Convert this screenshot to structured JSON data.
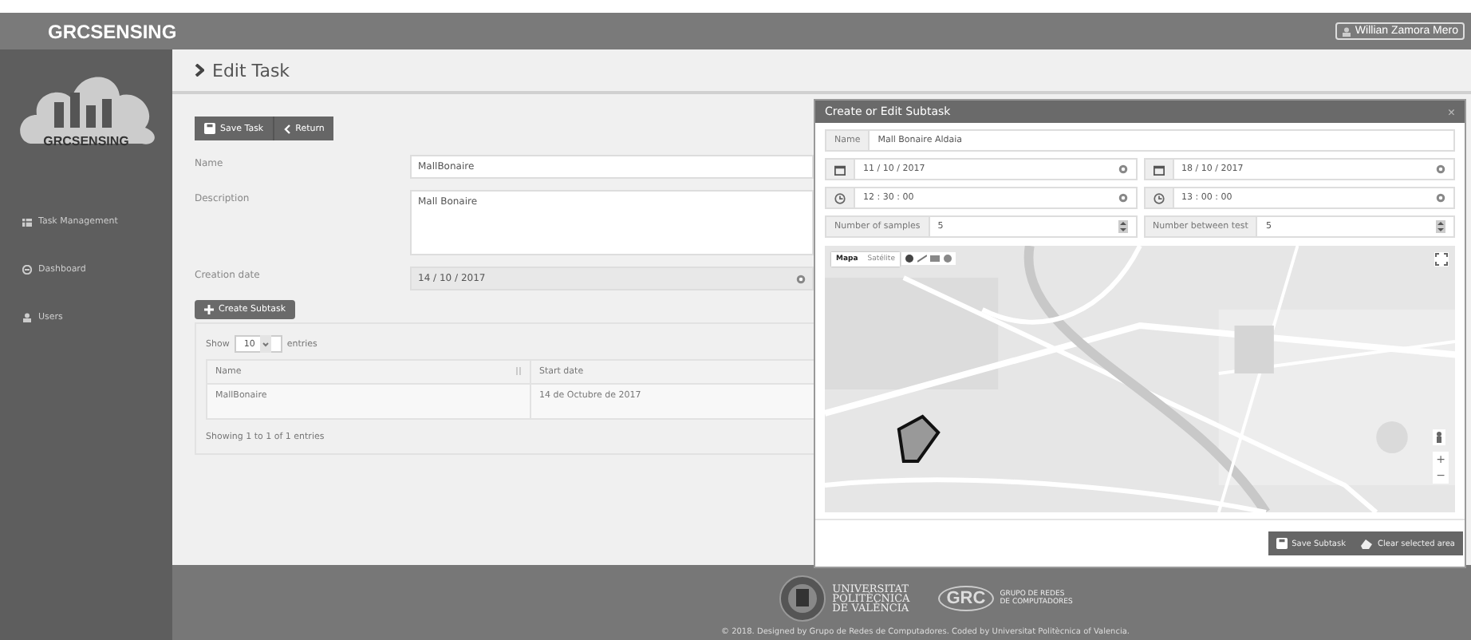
{
  "header": {
    "brand": "GRCSENSING",
    "user": "Willian Zamora Mero"
  },
  "sidebar": {
    "logo_text": "GRCSENSING",
    "items": [
      {
        "label": "Task Management",
        "kind": "table"
      },
      {
        "label": "Dashboard",
        "kind": "gauge"
      },
      {
        "label": "Users",
        "kind": "user"
      }
    ]
  },
  "page": {
    "title": "Edit Task",
    "toolbar": [
      {
        "label": "Save Task",
        "kind": "save"
      },
      {
        "label": "Return",
        "kind": "back"
      }
    ],
    "fields": [
      {
        "label": "Name",
        "value": "MallBonaire",
        "kind": "input"
      },
      {
        "label": "Description",
        "value": "Mall Bonaire",
        "kind": "textarea"
      },
      {
        "label": "Creation date",
        "value": "14 / 10 / 2017",
        "kind": "date",
        "disabled": true
      }
    ],
    "create_button": "Create Subtask",
    "table": {
      "length_prefix": "Show",
      "length_value": "10",
      "length_suffix": "entries",
      "columns": [
        "Name",
        "Start date"
      ],
      "rows": [
        [
          "MallBonaire",
          "14 de Octubre de 2017"
        ]
      ],
      "info": "Showing 1 to 1 of 1 entries"
    }
  },
  "modal": {
    "title": "Create or Edit Subtask",
    "close": "×",
    "name_label": "Name",
    "name_value": "Mall Bonaire Aldaia",
    "dates": [
      "11 / 10 / 2017",
      "18 / 10 / 2017"
    ],
    "times": [
      "12 : 30 : 00",
      "13 : 00 : 00"
    ],
    "counts": [
      {
        "label": "Number of samples",
        "value": "5"
      },
      {
        "label": "Number between test",
        "value": "5"
      }
    ],
    "map": {
      "view_types": [
        {
          "label": "Mapa",
          "selected": true
        },
        {
          "label": "Satélite",
          "selected": false
        }
      ],
      "zoom_in": "+",
      "zoom_out": "−"
    },
    "buttons": [
      {
        "label": "Save Subtask",
        "kind": "save"
      },
      {
        "label": "Clear selected area",
        "kind": "erase"
      }
    ]
  },
  "footer": {
    "university": [
      "UNIVERSITAT",
      "POLITÈCNICA",
      "DE VALÈNCIA"
    ],
    "group_mark": "GRC",
    "group": [
      "GRUPO DE REDES",
      "DE COMPUTADORES"
    ],
    "copyright": "© 2018. Designed by Grupo de Redes de Computadores. Coded by Universitat Politècnica of Valencia."
  }
}
